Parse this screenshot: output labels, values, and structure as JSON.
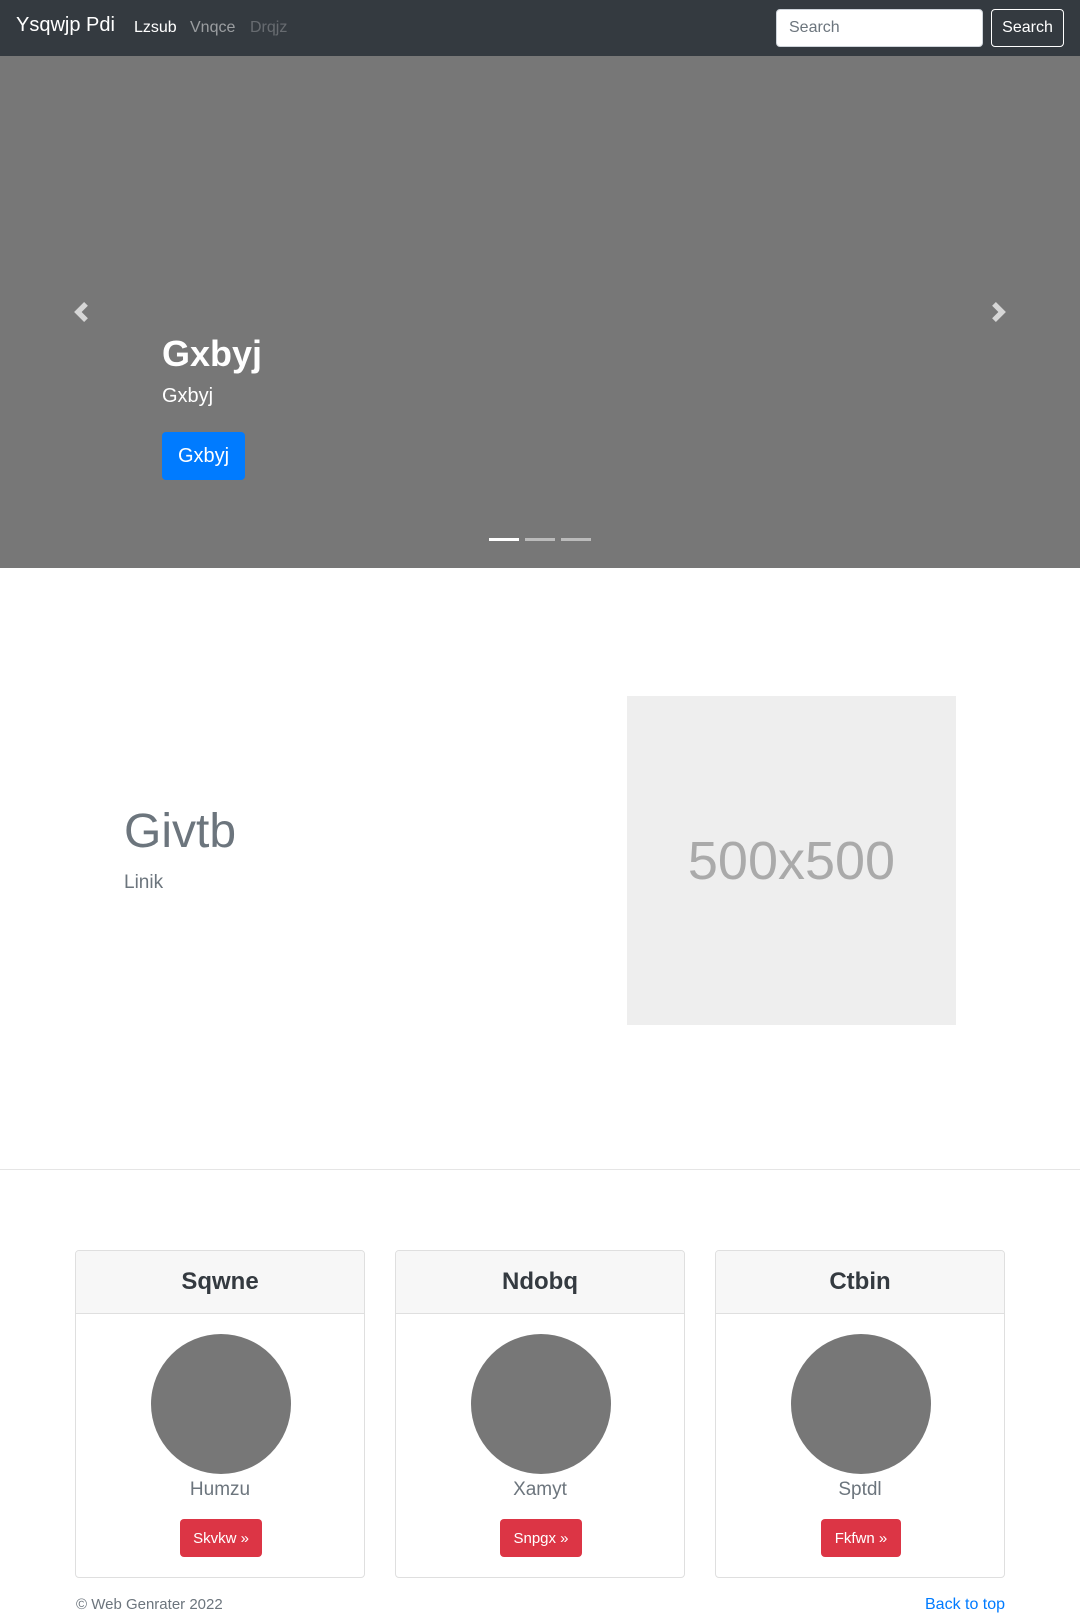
{
  "navbar": {
    "brand": "Ysqwjp Pdi",
    "links": [
      {
        "label": "Lzsub",
        "state": "active"
      },
      {
        "label": "Vnqce",
        "state": "normal"
      },
      {
        "label": "Drqjz",
        "state": "disabled"
      }
    ],
    "search_placeholder": "Search",
    "search_button": "Search"
  },
  "carousel": {
    "title": "Gxbyj",
    "subtitle": "Gxbyj",
    "button": "Gxbyj",
    "prev_icon": "chevron-left-icon",
    "next_icon": "chevron-right-icon",
    "slide_count": 3,
    "active_slide": 1
  },
  "feature": {
    "heading": "Givtb",
    "subheading": "Linik",
    "image_label": "500x500"
  },
  "cards": [
    {
      "title": "Sqwne",
      "name": "Humzu",
      "button": "Skvkw »"
    },
    {
      "title": "Ndobq",
      "name": "Xamyt",
      "button": "Snpgx »"
    },
    {
      "title": "Ctbin",
      "name": "Sptdl",
      "button": "Fkfwn »"
    }
  ],
  "footer": {
    "copyright": "© Web Genrater 2022",
    "back_to_top": "Back to top"
  },
  "colors": {
    "navbar_bg": "#343a40",
    "carousel_bg": "#777777",
    "primary": "#007bff",
    "danger": "#dc3545"
  }
}
